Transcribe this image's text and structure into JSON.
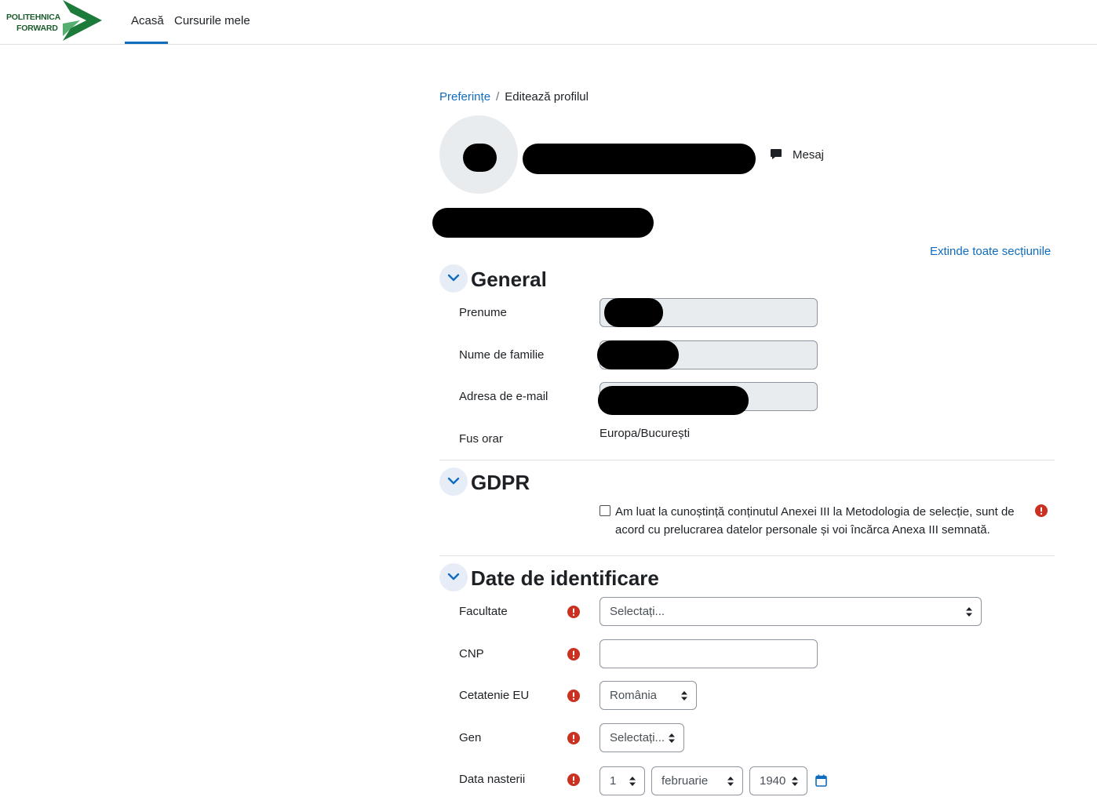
{
  "navbar": {
    "logo_line1": "POLITEHNICA",
    "logo_line2": "FORWARD",
    "home": "Acasă",
    "my_courses": "Cursurile mele"
  },
  "breadcrumb": {
    "parent": "Preferințe",
    "separator": "/",
    "current": "Editează profilul"
  },
  "profile": {
    "message_label": "Mesaj"
  },
  "expand_all": "Extinde toate secțiunile",
  "sections": {
    "general": {
      "title": "General",
      "first_name_label": "Prenume",
      "last_name_label": "Nume de familie",
      "email_label": "Adresa de e-mail",
      "timezone_label": "Fus orar",
      "timezone_value": "Europa/București"
    },
    "gdpr": {
      "title": "GDPR",
      "consent_text": "Am luat la cunoștință conținutul Anexei III la Metodologia de selecție, sunt de acord cu prelucrarea datelor personale și voi încărca Anexa III semnată."
    },
    "identification": {
      "title": "Date de identificare",
      "faculty_label": "Facultate",
      "faculty_value": "Selectați...",
      "cnp_label": "CNP",
      "cnp_value": "",
      "citizenship_label": "Cetatenie EU",
      "citizenship_value": "România",
      "gender_label": "Gen",
      "gender_value": "Selectați...",
      "birthdate_label": "Data nasterii",
      "birth_day": "1",
      "birth_month": "februarie",
      "birth_year": "1940"
    }
  },
  "colors": {
    "link": "#0f6cbf",
    "required": "#ca3120",
    "brand_green": "#1c5b2e"
  }
}
